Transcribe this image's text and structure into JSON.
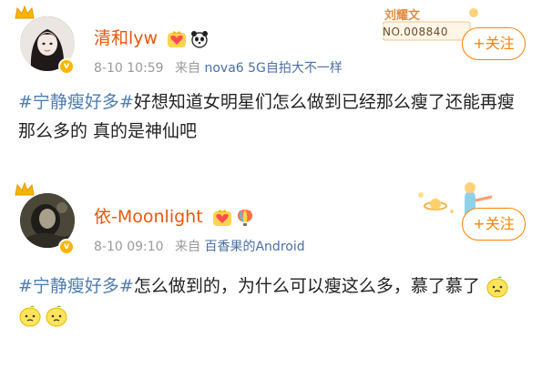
{
  "posts": [
    {
      "username": "清和lyw",
      "timestamp": "8-10 10:59",
      "source_prefix": "来自",
      "source": "nova6 5G自拍大不一样",
      "follow_label": "+关注",
      "hashtag": "#宁静瘦好多#",
      "text": "好想知道女明星们怎么做到已经那么瘦了还能再瘦那么多的 真的是神仙吧",
      "badges": [
        "crown-heart-icon",
        "panda-icon"
      ],
      "card_name": "刘耀文",
      "card_no": "NO.008840"
    },
    {
      "username": "依-Moonlight",
      "timestamp": "8-10 09:10",
      "source_prefix": "来自",
      "source": "百香果的Android",
      "follow_label": "+关注",
      "hashtag": "#宁静瘦好多#",
      "text": "怎么做到的，为什么可以瘦这么多，慕了慕了",
      "badges": [
        "crown-heart-icon",
        "hot-air-balloon-icon"
      ],
      "trailing_icons": [
        "lemon-face-icon",
        "lemon-face-icon",
        "lemon-face-icon"
      ]
    }
  ],
  "colors": {
    "username": "#e8580c",
    "hashtag": "#507daf",
    "follow": "#ff8200",
    "meta": "#999999"
  }
}
